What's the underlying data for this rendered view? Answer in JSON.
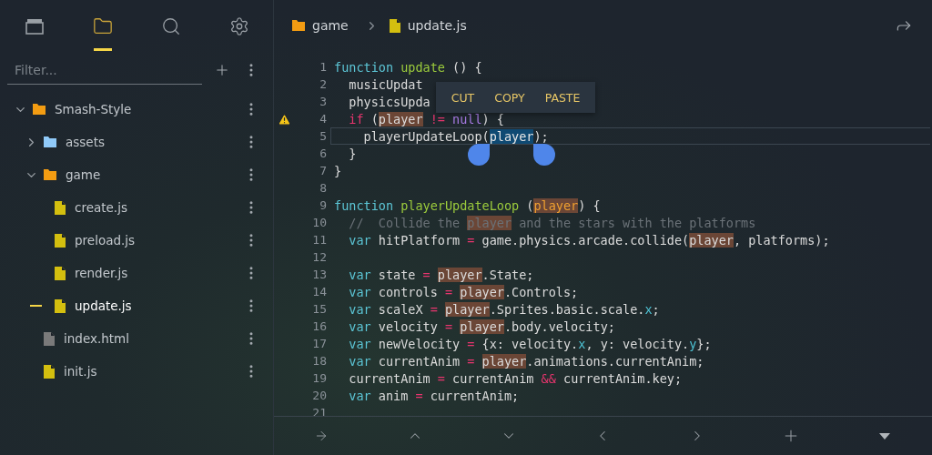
{
  "sidebar": {
    "tabs": [
      {
        "selected": false
      },
      {
        "selected": true
      },
      {
        "selected": false
      },
      {
        "selected": false
      }
    ],
    "filter": {
      "placeholder": "Filter..."
    },
    "tree": [
      {
        "label": "Smash-Style",
        "kind": "folder",
        "color": "#f39c12",
        "expanded": true,
        "active": false,
        "children": [
          {
            "label": "assets",
            "kind": "folder",
            "color": "#90caf9",
            "expanded": false,
            "active": false
          },
          {
            "label": "game",
            "kind": "folder",
            "color": "#f39c12",
            "expanded": true,
            "active": false,
            "children": [
              {
                "label": "create.js",
                "kind": "file",
                "color": "#d4bf0f",
                "active": false
              },
              {
                "label": "preload.js",
                "kind": "file",
                "color": "#d4bf0f",
                "active": false
              },
              {
                "label": "render.js",
                "kind": "file",
                "color": "#d4bf0f",
                "active": false
              },
              {
                "label": "update.js",
                "kind": "file",
                "color": "#d4bf0f",
                "active": true
              }
            ]
          },
          {
            "label": "index.html",
            "kind": "file",
            "color": "#7a7a7a",
            "active": false
          },
          {
            "label": "init.js",
            "kind": "file",
            "color": "#d4bf0f",
            "active": false
          }
        ]
      }
    ]
  },
  "breadcrumb": [
    {
      "label": "game",
      "kind": "folder",
      "color": "#f39c12"
    },
    {
      "label": "update.js",
      "kind": "file",
      "color": "#d4bf0f"
    }
  ],
  "editor": {
    "lines": [
      {
        "number": "1",
        "warning": false,
        "current": false,
        "tokens": [
          {
            "kind": "keyword",
            "text": "function"
          },
          {
            "kind": "function",
            "text": " update"
          },
          {
            "kind": "plain",
            "text": " () {"
          }
        ]
      },
      {
        "number": "2",
        "warning": false,
        "current": false,
        "tokens": [
          {
            "kind": "plain",
            "text": "  musicUpdat"
          }
        ]
      },
      {
        "number": "3",
        "warning": false,
        "current": false,
        "tokens": [
          {
            "kind": "plain",
            "text": "  physicsUpda"
          }
        ]
      },
      {
        "number": "4",
        "warning": true,
        "current": false,
        "tokens": [
          {
            "kind": "operator",
            "text": "  if"
          },
          {
            "kind": "plain",
            "text": " ("
          },
          {
            "kind": "match",
            "text": "player"
          },
          {
            "kind": "operator",
            "text": " !="
          },
          {
            "kind": "null",
            "text": " null"
          },
          {
            "kind": "plain",
            "text": ") {"
          }
        ]
      },
      {
        "number": "5",
        "warning": false,
        "current": true,
        "tokens": [
          {
            "kind": "plain",
            "text": "    playerUpdateLoop("
          },
          {
            "kind": "selection",
            "text": "player"
          },
          {
            "kind": "plain",
            "text": ");"
          }
        ]
      },
      {
        "number": "6",
        "warning": false,
        "current": false,
        "tokens": [
          {
            "kind": "plain",
            "text": "  }"
          }
        ]
      },
      {
        "number": "7",
        "warning": false,
        "current": false,
        "tokens": [
          {
            "kind": "plain",
            "text": "}"
          }
        ]
      },
      {
        "number": "8",
        "warning": false,
        "current": false
      },
      {
        "number": "9",
        "warning": false,
        "current": false,
        "tokens": [
          {
            "kind": "keyword",
            "text": "function"
          },
          {
            "kind": "function",
            "text": " playerUpdateLoop"
          },
          {
            "kind": "plain",
            "text": " ("
          },
          {
            "kind": "param",
            "text": "player"
          },
          {
            "kind": "plain",
            "text": ") {"
          }
        ]
      },
      {
        "number": "10",
        "warning": false,
        "current": false,
        "tokens": [
          {
            "kind": "comment",
            "text": "  //  Collide the "
          },
          {
            "kind": "comment-match",
            "text": "player"
          },
          {
            "kind": "comment",
            "text": " and the stars with the platforms"
          }
        ]
      },
      {
        "number": "11",
        "warning": false,
        "current": false,
        "tokens": [
          {
            "kind": "keyword",
            "text": "  var"
          },
          {
            "kind": "plain",
            "text": " hitPlatform "
          },
          {
            "kind": "operator",
            "text": "="
          },
          {
            "kind": "plain",
            "text": " game.physics.arcade.collide("
          },
          {
            "kind": "match",
            "text": "player"
          },
          {
            "kind": "plain",
            "text": ", platforms);"
          }
        ]
      },
      {
        "number": "12",
        "warning": false,
        "current": false
      },
      {
        "number": "13",
        "warning": false,
        "current": false,
        "tokens": [
          {
            "kind": "keyword",
            "text": "  var"
          },
          {
            "kind": "plain",
            "text": " state "
          },
          {
            "kind": "operator",
            "text": "= "
          },
          {
            "kind": "match",
            "text": "player"
          },
          {
            "kind": "plain",
            "text": ".State;"
          }
        ]
      },
      {
        "number": "14",
        "warning": false,
        "current": false,
        "tokens": [
          {
            "kind": "keyword",
            "text": "  var"
          },
          {
            "kind": "plain",
            "text": " controls "
          },
          {
            "kind": "operator",
            "text": "= "
          },
          {
            "kind": "match",
            "text": "player"
          },
          {
            "kind": "plain",
            "text": ".Controls;"
          }
        ]
      },
      {
        "number": "15",
        "warning": false,
        "current": false,
        "tokens": [
          {
            "kind": "keyword",
            "text": "  var"
          },
          {
            "kind": "plain",
            "text": " scaleX "
          },
          {
            "kind": "operator",
            "text": "= "
          },
          {
            "kind": "match",
            "text": "player"
          },
          {
            "kind": "plain",
            "text": ".Sprites.basic.scale."
          },
          {
            "kind": "property",
            "text": "x"
          },
          {
            "kind": "plain",
            "text": ";"
          }
        ]
      },
      {
        "number": "16",
        "warning": false,
        "current": false,
        "tokens": [
          {
            "kind": "keyword",
            "text": "  var"
          },
          {
            "kind": "plain",
            "text": " velocity "
          },
          {
            "kind": "operator",
            "text": "= "
          },
          {
            "kind": "match",
            "text": "player"
          },
          {
            "kind": "plain",
            "text": ".body.velocity;"
          }
        ]
      },
      {
        "number": "17",
        "warning": false,
        "current": false,
        "tokens": [
          {
            "kind": "keyword",
            "text": "  var"
          },
          {
            "kind": "plain",
            "text": " newVelocity "
          },
          {
            "kind": "operator",
            "text": "="
          },
          {
            "kind": "plain",
            "text": " {x: velocity."
          },
          {
            "kind": "property",
            "text": "x"
          },
          {
            "kind": "plain",
            "text": ", y: velocity."
          },
          {
            "kind": "property",
            "text": "y"
          },
          {
            "kind": "plain",
            "text": "};"
          }
        ]
      },
      {
        "number": "18",
        "warning": false,
        "current": false,
        "tokens": [
          {
            "kind": "keyword",
            "text": "  var"
          },
          {
            "kind": "plain",
            "text": " currentAnim "
          },
          {
            "kind": "operator",
            "text": "= "
          },
          {
            "kind": "match",
            "text": "player"
          },
          {
            "kind": "plain",
            "text": ".animations.currentAnim;"
          }
        ]
      },
      {
        "number": "19",
        "warning": false,
        "current": false,
        "tokens": [
          {
            "kind": "plain",
            "text": "  currentAnim "
          },
          {
            "kind": "operator",
            "text": "="
          },
          {
            "kind": "plain",
            "text": " currentAnim "
          },
          {
            "kind": "operator",
            "text": "&&"
          },
          {
            "kind": "plain",
            "text": " currentAnim.key;"
          }
        ]
      },
      {
        "number": "20",
        "warning": false,
        "current": false,
        "tokens": [
          {
            "kind": "keyword",
            "text": "  var"
          },
          {
            "kind": "plain",
            "text": " anim "
          },
          {
            "kind": "operator",
            "text": "="
          },
          {
            "kind": "plain",
            "text": " currentAnim;"
          }
        ]
      },
      {
        "number": "21",
        "warning": false,
        "current": false
      }
    ],
    "context_menu": [
      "CUT",
      "COPY",
      "PASTE"
    ]
  }
}
